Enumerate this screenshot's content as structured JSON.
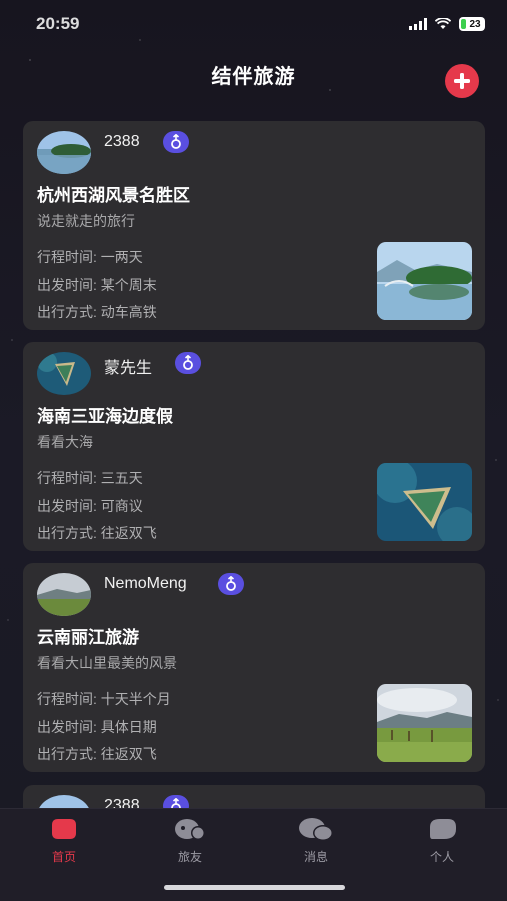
{
  "status_bar": {
    "time": "20:59",
    "battery": "23"
  },
  "header": {
    "title": "结伴旅游"
  },
  "cards": [
    {
      "username": "2388",
      "title": "杭州西湖风景名胜区",
      "subtitle": "说走就走的旅行",
      "duration": "行程时间: 一两天",
      "departure": "出发时间: 某个周末",
      "transport": "出行方式: 动车高铁"
    },
    {
      "username": "蒙先生",
      "title": "海南三亚海边度假",
      "subtitle": "看看大海",
      "duration": "行程时间: 三五天",
      "departure": "出发时间: 可商议",
      "transport": "出行方式: 往返双飞"
    },
    {
      "username": "NemoMeng",
      "title": "云南丽江旅游",
      "subtitle": "看看大山里最美的风景",
      "duration": "行程时间: 十天半个月",
      "departure": "出发时间: 具体日期",
      "transport": "出行方式: 往返双飞"
    },
    {
      "username": "2388"
    }
  ],
  "tabs": [
    {
      "label": "首页",
      "icon": "home-icon",
      "active": true
    },
    {
      "label": "旅友",
      "icon": "friends-icon",
      "active": false
    },
    {
      "label": "消息",
      "icon": "message-icon",
      "active": false
    },
    {
      "label": "个人",
      "icon": "profile-icon",
      "active": false
    }
  ],
  "colors": {
    "accent": "#e5394b",
    "badge": "#5a4fe0",
    "card": "#2e2d30",
    "background": "#17151f"
  }
}
